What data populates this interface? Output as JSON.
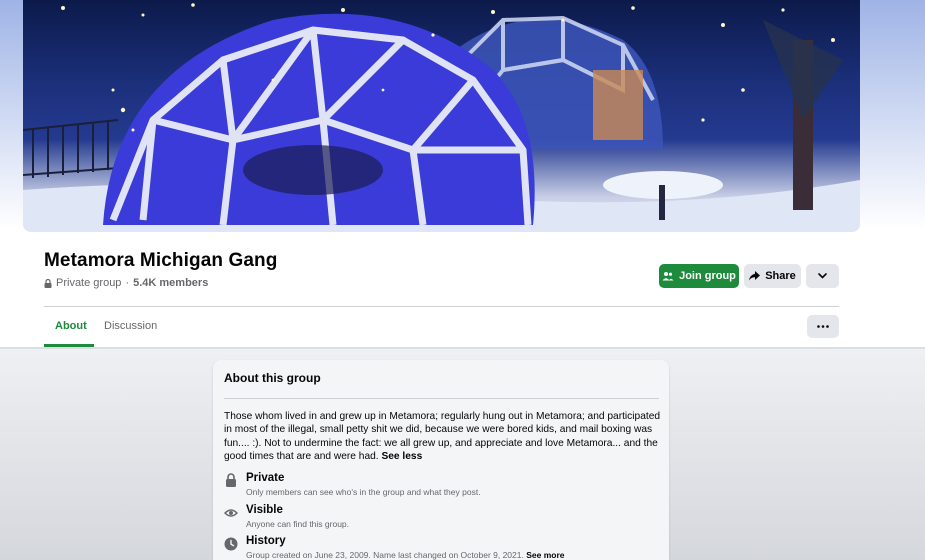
{
  "group": {
    "title": "Metamora Michigan Gang",
    "privacy": "Private group",
    "separator": "·",
    "members": "5.4K members"
  },
  "actions": {
    "join_label": "Join group",
    "share_label": "Share",
    "more_icon": "chevron-down-icon",
    "options_icon": "more-dots-icon"
  },
  "tabs": [
    {
      "label": "About",
      "active": true
    },
    {
      "label": "Discussion",
      "active": false
    }
  ],
  "about": {
    "title": "About this group",
    "description": "Those whom lived in and grew up in Metamora; regularly hung out in Metamora; and participated in most of the illegal, small petty shit we did, because we were bored kids, and mail boxing was fun.... :). Not to undermine the fact: we all grew up, and appreciate and love Metamora... and the good times that are and were had.",
    "see_less": "See less",
    "items": [
      {
        "icon": "lock-icon",
        "title": "Private",
        "subtitle": "Only members can see who's in the group and what they post."
      },
      {
        "icon": "eye-icon",
        "title": "Visible",
        "subtitle": "Anyone can find this group."
      },
      {
        "icon": "clock-icon",
        "title": "History",
        "subtitle": "Group created on June 23, 2009. Name last changed on October 9, 2021.",
        "see_more": "See more"
      }
    ]
  },
  "colors": {
    "accent_green": "#1e8a3c",
    "button_gray": "#e4e6eb",
    "text_secondary": "#65676b"
  }
}
